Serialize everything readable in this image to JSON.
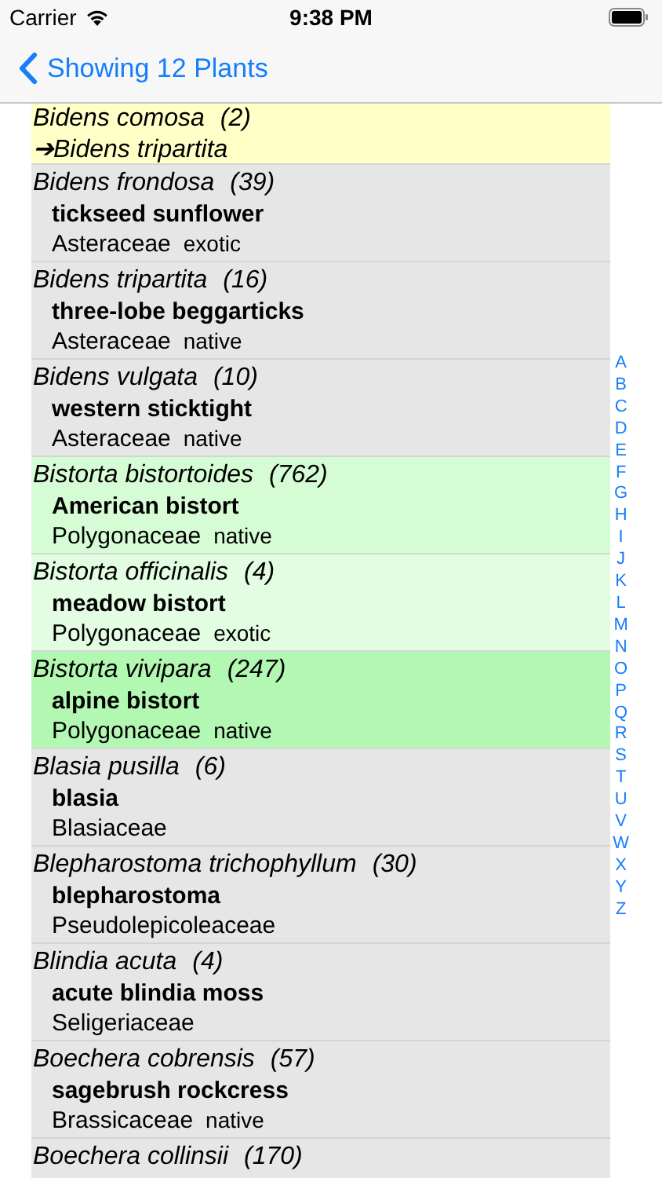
{
  "status_bar": {
    "carrier": "Carrier",
    "time": "9:38 PM"
  },
  "nav": {
    "back_label": "Showing 12 Plants"
  },
  "rows": [
    {
      "kind": "synonym",
      "name": "Bidens comosa",
      "count": "(2)",
      "target": "➔Bidens tripartita",
      "color": "#ffffc8"
    },
    {
      "kind": "plant",
      "name": "Bidens frondosa",
      "count": "(39)",
      "common": "tickseed sunflower",
      "family": "Asteraceae",
      "status": "exotic",
      "color": "#e6e6e6"
    },
    {
      "kind": "plant",
      "name": "Bidens tripartita",
      "count": "(16)",
      "common": "three-lobe beggarticks",
      "family": "Asteraceae",
      "status": "native",
      "color": "#e6e6e6"
    },
    {
      "kind": "plant",
      "name": "Bidens vulgata",
      "count": "(10)",
      "common": "western sticktight",
      "family": "Asteraceae",
      "status": "native",
      "color": "#e6e6e6"
    },
    {
      "kind": "plant",
      "name": "Bistorta bistortoides",
      "count": "(762)",
      "common": "American bistort",
      "family": "Polygonaceae",
      "status": "native",
      "color": "#d6fcd6"
    },
    {
      "kind": "plant",
      "name": "Bistorta officinalis",
      "count": "(4)",
      "common": "meadow bistort",
      "family": "Polygonaceae",
      "status": "exotic",
      "color": "#e2fde2"
    },
    {
      "kind": "plant",
      "name": "Bistorta vivipara",
      "count": "(247)",
      "common": "alpine bistort",
      "family": "Polygonaceae",
      "status": "native",
      "color": "#b2f8b2"
    },
    {
      "kind": "plant",
      "name": "Blasia pusilla",
      "count": "(6)",
      "common": "blasia",
      "family": "Blasiaceae",
      "color": "#e6e6e6"
    },
    {
      "kind": "plant",
      "name": "Blepharostoma trichophyllum",
      "count": "(30)",
      "common": "blepharostoma",
      "family": "Pseudolepicoleaceae",
      "color": "#e6e6e6"
    },
    {
      "kind": "plant",
      "name": "Blindia acuta",
      "count": "(4)",
      "common": "acute blindia moss",
      "family": "Seligeriaceae",
      "color": "#e6e6e6"
    },
    {
      "kind": "plant",
      "name": "Boechera cobrensis",
      "count": "(57)",
      "common": "sagebrush rockcress",
      "family": "Brassicaceae",
      "status": "native",
      "color": "#e6e6e6"
    },
    {
      "kind": "plant",
      "name": "Boechera collinsii",
      "count": "(170)",
      "color": "#e6e6e6"
    }
  ],
  "index_letters": [
    "A",
    "B",
    "C",
    "D",
    "E",
    "F",
    "G",
    "H",
    "I",
    "J",
    "K",
    "L",
    "M",
    "N",
    "O",
    "P",
    "Q",
    "R",
    "S",
    "T",
    "U",
    "V",
    "W",
    "X",
    "Y",
    "Z"
  ]
}
